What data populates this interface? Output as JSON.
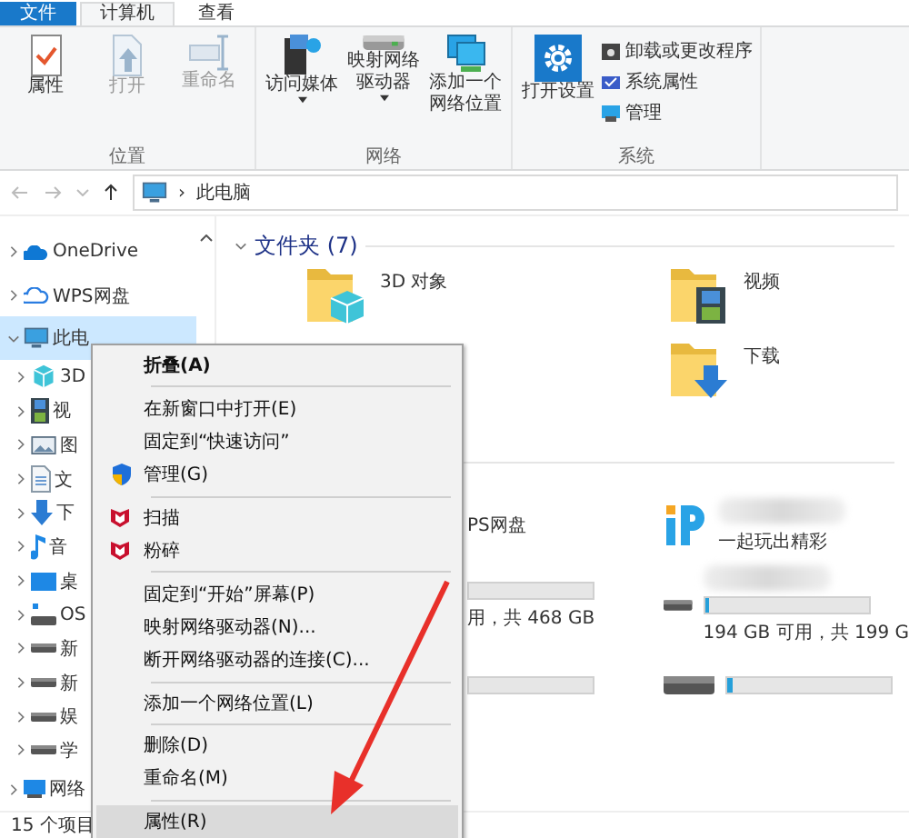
{
  "ribbon_tabs": [
    {
      "label": "文件",
      "selected": false,
      "kind": "file"
    },
    {
      "label": "计算机",
      "selected": true,
      "kind": "plain"
    },
    {
      "label": "查看",
      "selected": false,
      "kind": "plain"
    }
  ],
  "ribbon_groups": [
    {
      "name": "位置",
      "buttons": [
        {
          "label": "属性",
          "kind": "props",
          "disabled": false,
          "dropdown": false
        },
        {
          "label": "打开",
          "kind": "open",
          "disabled": true,
          "dropdown": false
        },
        {
          "label": "重命名",
          "kind": "rename",
          "disabled": true,
          "dropdown": false
        }
      ]
    },
    {
      "name": "网络",
      "buttons": [
        {
          "label": "访问媒体",
          "kind": "media",
          "disabled": false,
          "dropdown": true
        },
        {
          "label": "映射网络驱动器",
          "kind": "drive",
          "disabled": false,
          "dropdown": true
        },
        {
          "label": "添加一个网络位置",
          "kind": "netloc",
          "disabled": false,
          "dropdown": false
        }
      ]
    },
    {
      "name": "系统",
      "buttons": [
        {
          "label": "打开设置",
          "kind": "gear",
          "disabled": false,
          "dropdown": false
        },
        {
          "label": "卸载或更改程序",
          "kind": "uninstall"
        },
        {
          "label": "系统属性",
          "kind": "sysprops"
        },
        {
          "label": "管理",
          "kind": "manage"
        }
      ]
    }
  ],
  "address_bar": {
    "separator": "›",
    "path": "此电脑"
  },
  "nav_pane": [
    {
      "label": "OneDrive",
      "kind": "cloud",
      "selected": false,
      "expanded": false
    },
    {
      "label": "WPS网盘",
      "kind": "wpscloud",
      "selected": false,
      "expanded": false
    },
    {
      "label": "此电",
      "kind": "pc",
      "selected": true,
      "expanded": true,
      "children": [
        {
          "label": "3D",
          "kind": "cube",
          "selected": false,
          "expanded": false
        },
        {
          "label": "视",
          "kind": "video",
          "selected": false,
          "expanded": false
        },
        {
          "label": "图",
          "kind": "picture",
          "selected": false,
          "expanded": false
        },
        {
          "label": "文",
          "kind": "doc",
          "selected": false,
          "expanded": false
        },
        {
          "label": "下",
          "kind": "download",
          "selected": false,
          "expanded": false
        },
        {
          "label": "音",
          "kind": "music",
          "selected": false,
          "expanded": false
        },
        {
          "label": "桌",
          "kind": "desktop",
          "selected": false,
          "expanded": false
        },
        {
          "label": "OS",
          "kind": "osdrive",
          "selected": false,
          "expanded": false
        },
        {
          "label": "新",
          "kind": "drive",
          "selected": false,
          "expanded": false
        },
        {
          "label": "新",
          "kind": "drive",
          "selected": false,
          "expanded": false
        },
        {
          "label": "娱",
          "kind": "drive",
          "selected": false,
          "expanded": false
        },
        {
          "label": "学",
          "kind": "drive",
          "selected": false,
          "expanded": false
        }
      ]
    },
    {
      "label": "网络",
      "kind": "network",
      "selected": false,
      "expanded": false
    }
  ],
  "folders_section": {
    "title": "文件夹 (7)",
    "expanded": true,
    "items": [
      {
        "label": "3D 对象",
        "kind": "cube"
      },
      {
        "label": "视频",
        "kind": "video"
      },
      {
        "label": "下载",
        "kind": "download"
      }
    ]
  },
  "devices": [
    {
      "kind": "wps",
      "name": "PS网盘"
    },
    {
      "kind": "ip",
      "detail": "一起玩出精彩"
    },
    {
      "kind": "bar",
      "detail": "用，共 468 GB"
    },
    {
      "kind": "drive",
      "detail": "194 GB 可用，共 199 G",
      "level": 0.03
    },
    {
      "kind": "bar"
    },
    {
      "kind": "drive",
      "level": 0.03
    }
  ],
  "context_menu": [
    {
      "kind": "plain",
      "label": "折叠(A)",
      "bold": true,
      "selected": false
    },
    {
      "kind": "separator"
    },
    {
      "kind": "plain",
      "label": "在新窗口中打开(E)",
      "bold": false,
      "selected": false
    },
    {
      "kind": "plain",
      "label": "固定到“快速访问”",
      "bold": false,
      "selected": false
    },
    {
      "kind": "shield",
      "label": "管理(G)",
      "bold": false,
      "selected": false
    },
    {
      "kind": "separator"
    },
    {
      "kind": "mcafee",
      "label": "扫描",
      "bold": false,
      "selected": false
    },
    {
      "kind": "mcafee",
      "label": "粉碎",
      "bold": false,
      "selected": false
    },
    {
      "kind": "separator"
    },
    {
      "kind": "plain",
      "label": "固定到“开始”屏幕(P)",
      "bold": false,
      "selected": false
    },
    {
      "kind": "plain",
      "label": "映射网络驱动器(N)...",
      "bold": false,
      "selected": false
    },
    {
      "kind": "plain",
      "label": "断开网络驱动器的连接(C)...",
      "bold": false,
      "selected": false
    },
    {
      "kind": "separator"
    },
    {
      "kind": "plain",
      "label": "添加一个网络位置(L)",
      "bold": false,
      "selected": false
    },
    {
      "kind": "separator"
    },
    {
      "kind": "plain",
      "label": "删除(D)",
      "bold": false,
      "selected": false
    },
    {
      "kind": "plain",
      "label": "重命名(M)",
      "bold": false,
      "selected": false
    },
    {
      "kind": "separator"
    },
    {
      "kind": "plain",
      "label": "属性(R)",
      "bold": false,
      "selected": true
    }
  ],
  "status_bar": {
    "count": "15 个项目"
  }
}
